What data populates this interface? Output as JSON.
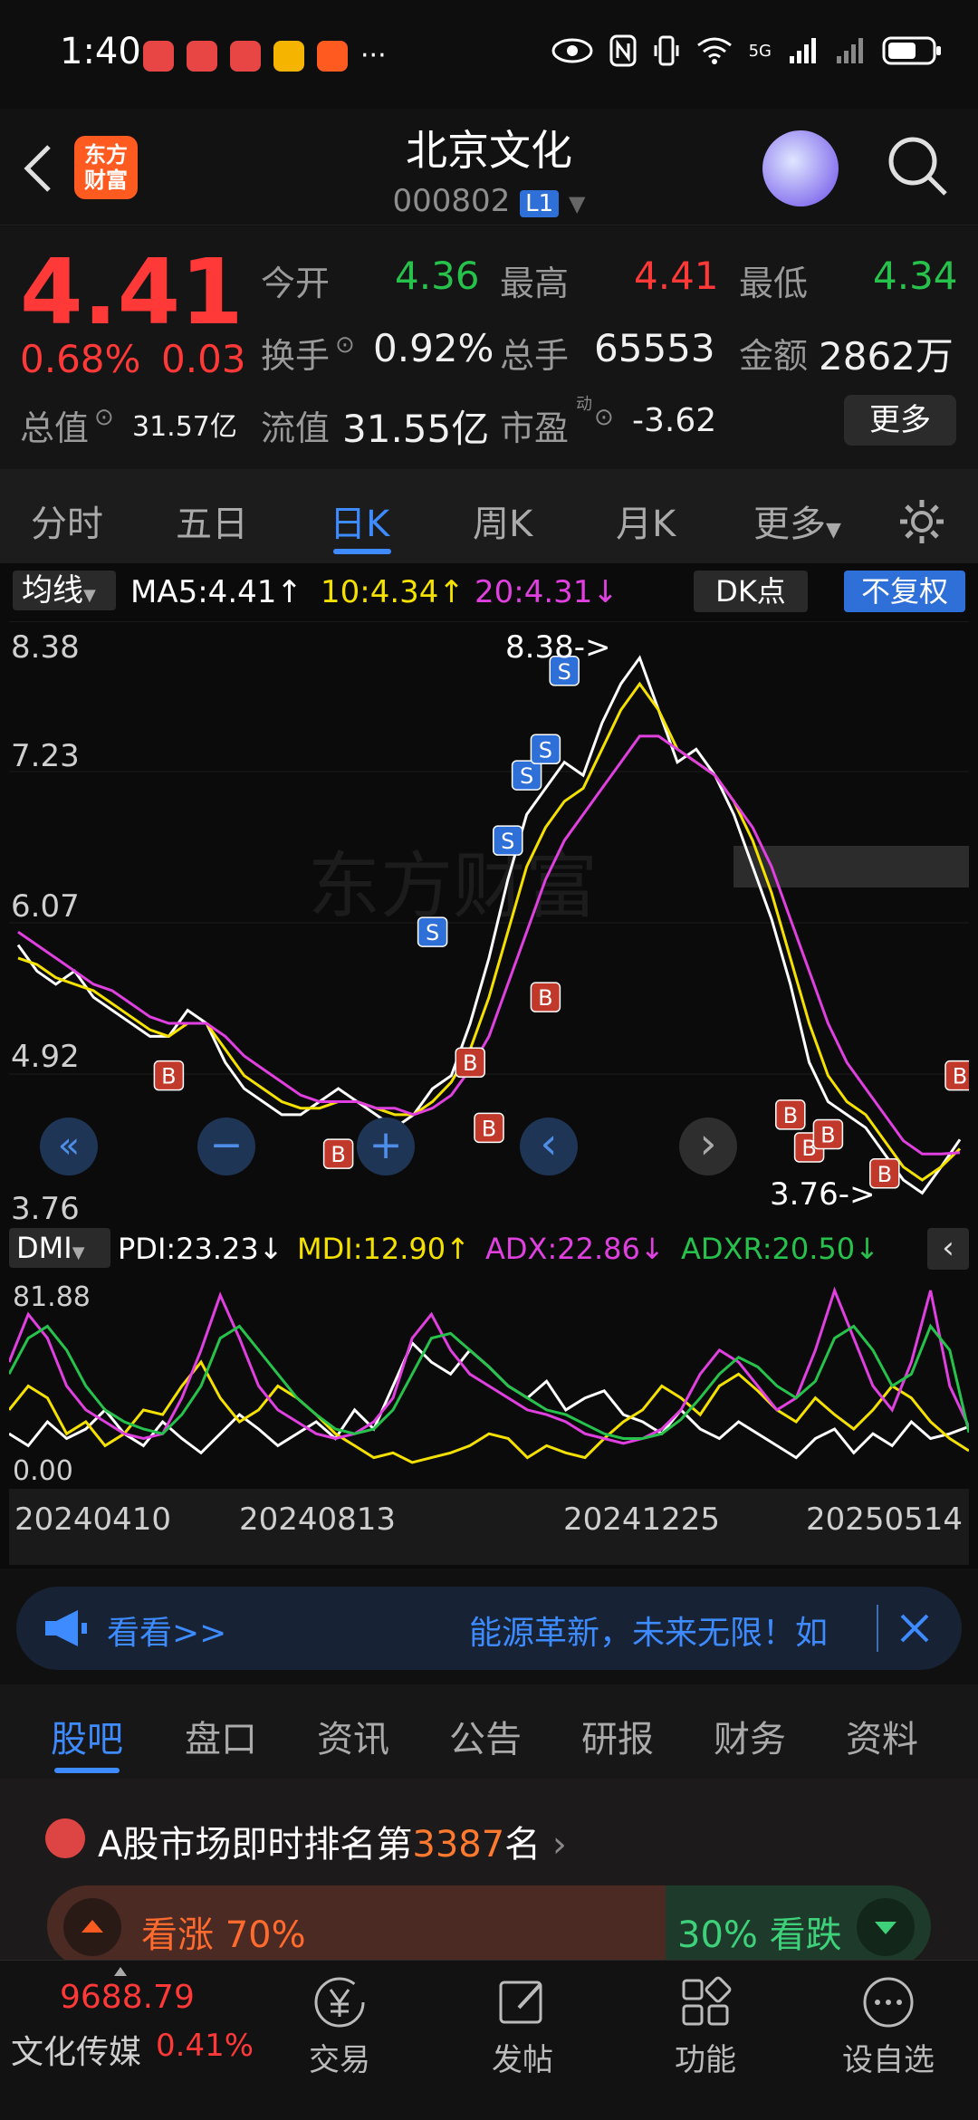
{
  "status": {
    "time": "1:40",
    "more": "···",
    "network": "5G"
  },
  "header": {
    "logo_line1": "东方",
    "logo_line2": "财富",
    "title": "北京文化",
    "code": "000802",
    "level": "L1"
  },
  "quote": {
    "price": "4.41",
    "change_pct": "0.68%",
    "change": "0.03",
    "open_label": "今开",
    "open": "4.36",
    "high_label": "最高",
    "high": "4.41",
    "low_label": "最低",
    "low": "4.34",
    "turnover_label": "换手",
    "turnover": "0.92%",
    "volume_label": "总手",
    "volume": "65553",
    "amount_label": "金额",
    "amount": "2862万",
    "mcap_label": "总值",
    "mcap": "31.57亿",
    "float_label": "流值",
    "float": "31.55亿",
    "pe_label": "市盈",
    "pe_sup": "动",
    "pe": "-3.62",
    "more_button": "更多"
  },
  "tabs": [
    "分时",
    "五日",
    "日K",
    "周K",
    "月K",
    "更多"
  ],
  "chart_header": {
    "ma_selector": "均线",
    "ma5": "MA5:4.41↑",
    "ma10": "10:4.34↑",
    "ma20": "20:4.31↓",
    "dk": "DK点",
    "adjust": "不复权"
  },
  "chart_data": {
    "type": "line",
    "ylim": [
      3.76,
      8.38
    ],
    "y_ticks": [
      "8.38",
      "7.23",
      "6.07",
      "4.92",
      "3.76"
    ],
    "max_label": "8.38->",
    "min_label": "3.76->",
    "x_ticks": [
      "20240410",
      "20240813",
      "20241225",
      "20250514"
    ],
    "series": [
      {
        "name": "MA5",
        "color": "#ffffff",
        "values": [
          5.9,
          5.7,
          5.6,
          5.7,
          5.5,
          5.4,
          5.3,
          5.2,
          5.2,
          5.4,
          5.3,
          5.0,
          4.8,
          4.7,
          4.6,
          4.6,
          4.7,
          4.8,
          4.7,
          4.6,
          4.5,
          4.6,
          4.8,
          4.9,
          5.3,
          5.8,
          6.4,
          6.9,
          7.1,
          7.3,
          7.2,
          7.6,
          7.9,
          8.1,
          7.7,
          7.3,
          7.4,
          7.2,
          6.9,
          6.5,
          6.1,
          5.6,
          5.0,
          4.7,
          4.6,
          4.5,
          4.3,
          4.1,
          4.0,
          4.2,
          4.41
        ]
      },
      {
        "name": "MA10",
        "color": "#f5e100",
        "values": [
          5.8,
          5.75,
          5.65,
          5.6,
          5.55,
          5.45,
          5.35,
          5.25,
          5.2,
          5.3,
          5.3,
          5.1,
          4.9,
          4.8,
          4.7,
          4.65,
          4.65,
          4.7,
          4.7,
          4.65,
          4.6,
          4.6,
          4.7,
          4.85,
          5.1,
          5.5,
          6.0,
          6.5,
          6.8,
          7.0,
          7.1,
          7.4,
          7.7,
          7.9,
          7.7,
          7.4,
          7.3,
          7.2,
          7.0,
          6.7,
          6.3,
          5.8,
          5.3,
          4.9,
          4.7,
          4.6,
          4.4,
          4.2,
          4.1,
          4.2,
          4.34
        ]
      },
      {
        "name": "MA20",
        "color": "#e040e0",
        "values": [
          6.0,
          5.9,
          5.8,
          5.7,
          5.6,
          5.55,
          5.45,
          5.35,
          5.3,
          5.3,
          5.3,
          5.2,
          5.05,
          4.95,
          4.85,
          4.75,
          4.7,
          4.7,
          4.7,
          4.65,
          4.65,
          4.6,
          4.65,
          4.75,
          4.95,
          5.2,
          5.6,
          6.0,
          6.4,
          6.7,
          6.9,
          7.1,
          7.3,
          7.5,
          7.5,
          7.4,
          7.3,
          7.2,
          7.0,
          6.8,
          6.5,
          6.1,
          5.7,
          5.3,
          5.0,
          4.8,
          4.6,
          4.4,
          4.3,
          4.3,
          4.31
        ]
      }
    ],
    "markers": [
      {
        "type": "B",
        "i": 8,
        "v": 4.9
      },
      {
        "type": "B",
        "i": 17,
        "v": 4.3
      },
      {
        "type": "B",
        "i": 24,
        "v": 5.0
      },
      {
        "type": "B",
        "i": 25,
        "v": 4.5
      },
      {
        "type": "B",
        "i": 28,
        "v": 5.5
      },
      {
        "type": "S",
        "i": 22,
        "v": 6.0
      },
      {
        "type": "S",
        "i": 26,
        "v": 6.7
      },
      {
        "type": "S",
        "i": 27,
        "v": 7.2
      },
      {
        "type": "S",
        "i": 28,
        "v": 7.4
      },
      {
        "type": "S",
        "i": 29,
        "v": 8.0
      },
      {
        "type": "B",
        "i": 41,
        "v": 4.6
      },
      {
        "type": "B",
        "i": 42,
        "v": 4.35
      },
      {
        "type": "B",
        "i": 43,
        "v": 4.45
      },
      {
        "type": "B",
        "i": 46,
        "v": 4.15
      },
      {
        "type": "B",
        "i": 50,
        "v": 4.9
      }
    ]
  },
  "chart_controls": [
    "«",
    "−",
    "+",
    "‹",
    "›"
  ],
  "dmi": {
    "selector": "DMI",
    "pdi": "PDI:23.23↓",
    "mdi": "MDI:12.90↑",
    "adx": "ADX:22.86↓",
    "adxr": "ADXR:20.50↓",
    "y_top": "81.88",
    "y_bottom": "0.00",
    "chart_data": {
      "type": "line",
      "ylim": [
        0,
        81.88
      ],
      "series": [
        {
          "name": "PDI",
          "color": "#ffffff",
          "values": [
            20,
            15,
            25,
            18,
            22,
            30,
            20,
            15,
            25,
            18,
            12,
            20,
            28,
            22,
            15,
            20,
            25,
            18,
            30,
            22,
            40,
            58,
            50,
            45,
            55,
            48,
            40,
            35,
            42,
            30,
            35,
            38,
            28,
            25,
            20,
            30,
            22,
            18,
            25,
            20,
            15,
            10,
            18,
            22,
            12,
            20,
            15,
            25,
            18,
            20,
            23
          ]
        },
        {
          "name": "MDI",
          "color": "#f5e100",
          "values": [
            30,
            40,
            35,
            20,
            25,
            15,
            20,
            30,
            28,
            40,
            50,
            35,
            25,
            30,
            40,
            35,
            28,
            20,
            15,
            10,
            12,
            8,
            10,
            12,
            15,
            20,
            18,
            10,
            15,
            12,
            10,
            18,
            25,
            30,
            40,
            35,
            28,
            40,
            45,
            38,
            30,
            25,
            35,
            28,
            22,
            30,
            40,
            35,
            25,
            18,
            12.9
          ]
        },
        {
          "name": "ADX",
          "color": "#e040e0",
          "values": [
            50,
            70,
            60,
            40,
            30,
            25,
            20,
            18,
            20,
            35,
            55,
            78,
            60,
            40,
            30,
            25,
            20,
            18,
            20,
            25,
            35,
            60,
            70,
            55,
            45,
            40,
            35,
            30,
            28,
            25,
            20,
            18,
            16,
            18,
            22,
            30,
            45,
            55,
            50,
            40,
            30,
            35,
            55,
            80,
            60,
            40,
            30,
            50,
            80,
            40,
            22.86
          ]
        },
        {
          "name": "ADXR",
          "color": "#27c24c",
          "values": [
            45,
            60,
            65,
            55,
            40,
            30,
            25,
            22,
            20,
            28,
            40,
            60,
            65,
            55,
            45,
            35,
            28,
            22,
            20,
            22,
            30,
            45,
            60,
            62,
            55,
            48,
            40,
            35,
            30,
            28,
            24,
            20,
            18,
            18,
            20,
            26,
            35,
            45,
            52,
            48,
            40,
            35,
            42,
            60,
            65,
            55,
            40,
            45,
            65,
            55,
            20.5
          ]
        }
      ]
    }
  },
  "banner": {
    "prefix": "看看>>",
    "text": "能源革新，未来无限！如"
  },
  "section_tabs": [
    "股吧",
    "盘口",
    "资讯",
    "公告",
    "研报",
    "财务",
    "资料"
  ],
  "rank": {
    "prefix": "A股市场即时排名第",
    "number": "3387",
    "suffix": "名"
  },
  "sentiment": {
    "up": "看涨 70%",
    "down": "30% 看跌",
    "up_pct": 70
  },
  "bottom": {
    "index_value": "9688.79",
    "index_name": "文化传媒",
    "index_change": "0.41%",
    "items": [
      "交易",
      "发帖",
      "功能",
      "设自选"
    ]
  }
}
